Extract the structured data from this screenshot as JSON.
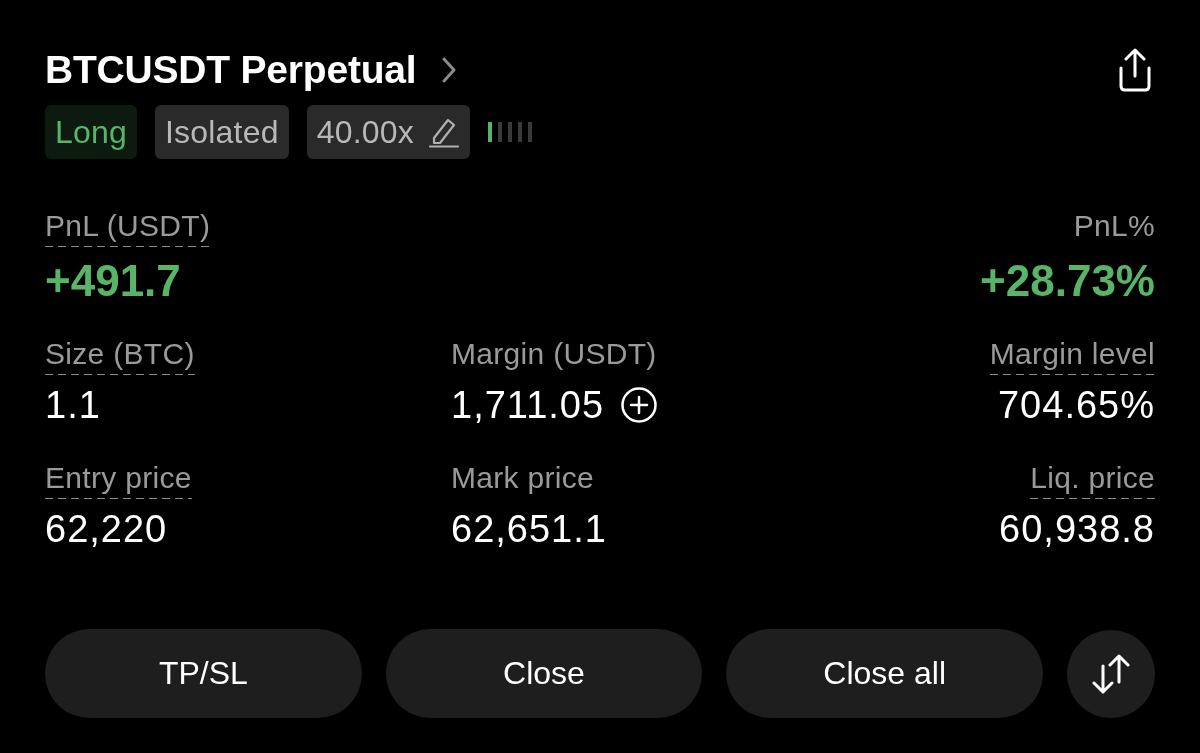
{
  "header": {
    "title": "BTCUSDT Perpetual"
  },
  "tags": [
    {
      "kind": "side",
      "label": "Long"
    },
    {
      "kind": "mode",
      "label": "Isolated"
    },
    {
      "kind": "leverage",
      "label": "40.00x"
    }
  ],
  "margin_meter": {
    "level": 0.2
  },
  "pnl": {
    "amount": {
      "label": "PnL (USDT)",
      "value": "+491.7",
      "has_tooltip": true,
      "positive": true
    },
    "percent": {
      "label": "PnL%",
      "value": "+28.73%",
      "has_tooltip": false,
      "positive": true
    }
  },
  "details": [
    {
      "label": "Size (BTC)",
      "value": "1.1",
      "has_tooltip": true,
      "positive": false,
      "addable": false
    },
    {
      "label": "Margin (USDT)",
      "value": "1,711.05",
      "has_tooltip": false,
      "positive": false,
      "addable": true
    },
    {
      "label": "Margin level",
      "value": "704.65%",
      "has_tooltip": true,
      "positive": false,
      "addable": false
    },
    {
      "label": "Entry price",
      "value": "62,220",
      "has_tooltip": true,
      "positive": false,
      "addable": false
    },
    {
      "label": "Mark price",
      "value": "62,651.1",
      "has_tooltip": false,
      "positive": false,
      "addable": false
    },
    {
      "label": "Liq. price",
      "value": "60,938.8",
      "has_tooltip": true,
      "positive": false,
      "addable": false
    }
  ],
  "actions": [
    {
      "label": "TP/SL"
    },
    {
      "label": "Close"
    },
    {
      "label": "Close all"
    }
  ]
}
